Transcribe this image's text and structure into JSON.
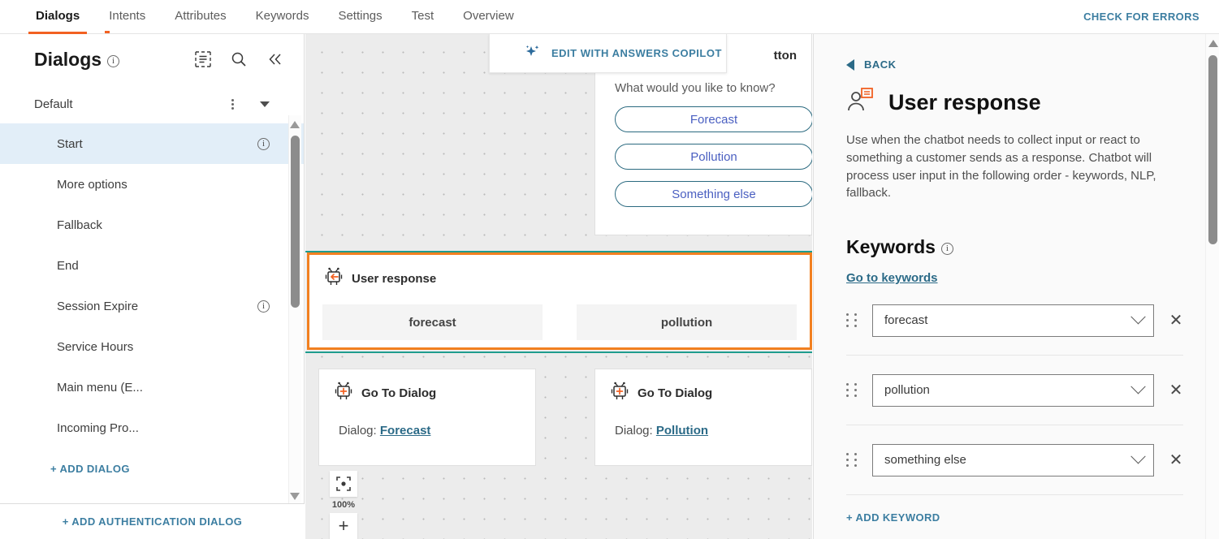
{
  "topnav": {
    "tabs": [
      {
        "label": "Dialogs",
        "active": true
      },
      {
        "label": "Intents",
        "active": false
      },
      {
        "label": "Attributes",
        "active": false
      },
      {
        "label": "Keywords",
        "active": false
      },
      {
        "label": "Settings",
        "active": false
      },
      {
        "label": "Test",
        "active": false
      },
      {
        "label": "Overview",
        "active": false
      }
    ],
    "check_errors_label": "CHECK FOR ERRORS"
  },
  "sidebar": {
    "title": "Dialogs",
    "group_label": "Default",
    "items": [
      {
        "label": "Start",
        "selected": true,
        "info": true
      },
      {
        "label": "More options",
        "selected": false,
        "info": false
      },
      {
        "label": "Fallback",
        "selected": false,
        "info": false
      },
      {
        "label": "End",
        "selected": false,
        "info": false
      },
      {
        "label": "Session Expire",
        "selected": false,
        "info": true
      },
      {
        "label": "Service Hours",
        "selected": false,
        "info": false
      },
      {
        "label": "Main menu (E...",
        "selected": false,
        "info": false
      },
      {
        "label": "Incoming Pro...",
        "selected": false,
        "info": false
      }
    ],
    "add_dialog_label": "+ ADD DIALOG",
    "add_auth_dialog_label": "+ ADD AUTHENTICATION DIALOG"
  },
  "copilot": {
    "label": "EDIT WITH ANSWERS COPILOT"
  },
  "canvas": {
    "zoom_level": "100%",
    "buttons_node": {
      "title_fragment": "tton",
      "question": "What would you like to know?",
      "buttons": [
        "Forecast",
        "Pollution",
        "Something else"
      ]
    },
    "user_response_node": {
      "title": "User response",
      "chips": [
        "forecast",
        "pollution"
      ]
    },
    "goto_nodes": [
      {
        "title": "Go To Dialog",
        "prefix": "Dialog:",
        "target": "Forecast"
      },
      {
        "title": "Go To Dialog",
        "prefix": "Dialog:",
        "target": "Pollution"
      }
    ]
  },
  "right_panel": {
    "back_label": "BACK",
    "title": "User response",
    "description": "Use when the chatbot needs to collect input or react to something a customer sends as a response. Chatbot will process user input in the following order - keywords, NLP, fallback.",
    "keywords_heading": "Keywords",
    "go_to_keywords_label": "Go to keywords",
    "keywords": [
      {
        "value": "forecast"
      },
      {
        "value": "pollution"
      },
      {
        "value": "something else"
      }
    ],
    "add_keyword_label": "+ ADD KEYWORD"
  },
  "colors": {
    "accent_orange": "#f26122",
    "link_blue": "#3c7ea1",
    "selected_blue": "#e2eef8",
    "teal": "#1e9c8e"
  }
}
